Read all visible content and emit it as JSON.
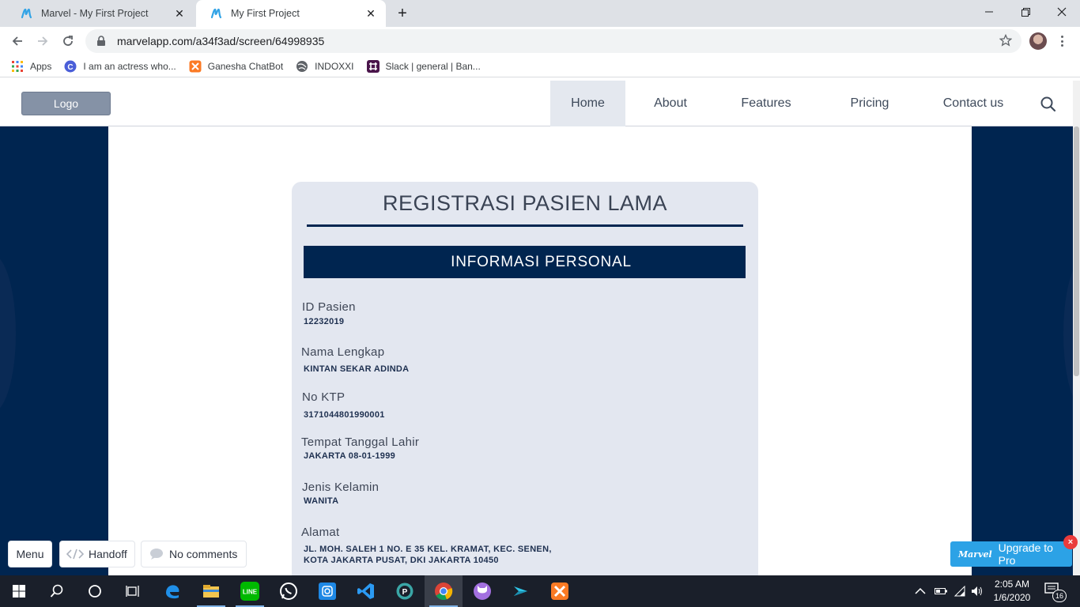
{
  "browser": {
    "tabs": [
      {
        "title": "Marvel - My First Project",
        "active": false
      },
      {
        "title": "My First Project",
        "active": true
      }
    ],
    "url": "marvelapp.com/a34f3ad/screen/64998935",
    "bookmarks": [
      {
        "label": "Apps",
        "icon": "apps-grid-icon"
      },
      {
        "label": "I am an actress who...",
        "icon": "c-circle-icon"
      },
      {
        "label": "Ganesha ChatBot",
        "icon": "xampp-icon"
      },
      {
        "label": "INDOXXI",
        "icon": "globe-icon"
      },
      {
        "label": "Slack | general | Ban...",
        "icon": "slack-icon"
      }
    ]
  },
  "site": {
    "logo_label": "Logo",
    "nav": [
      {
        "label": "Home",
        "active": true
      },
      {
        "label": "About"
      },
      {
        "label": "Features"
      },
      {
        "label": "Pricing"
      },
      {
        "label": "Contact us"
      }
    ]
  },
  "form": {
    "title": "REGISTRASI PASIEN LAMA",
    "section": "INFORMASI PERSONAL",
    "fields": [
      {
        "label": "ID Pasien",
        "value": "12232019"
      },
      {
        "label": "Nama Lengkap",
        "value": "KINTAN SEKAR ADINDA"
      },
      {
        "label": "No KTP",
        "value": "3171044801990001"
      },
      {
        "label": "Tempat Tanggal Lahir",
        "value": "JAKARTA 08-01-1999"
      },
      {
        "label": "Jenis Kelamin",
        "value": "WANITA"
      },
      {
        "label": "Alamat",
        "value_line1": "JL. MOH. SALEH 1 NO. E 35 KEL. KRAMAT, KEC. SENEN,",
        "value_line2": "KOTA JAKARTA PUSAT, DKI JAKARTA 10450"
      }
    ]
  },
  "marvel": {
    "menu_label": "Menu",
    "handoff_label": "Handoff",
    "comments_label": "No comments",
    "upgrade_brand": "Marvel",
    "upgrade_label": "Upgrade to Pro",
    "close_glyph": "×"
  },
  "taskbar": {
    "time": "2:05 AM",
    "date": "1/6/2020",
    "notification_count": "16"
  },
  "colors": {
    "navy": "#002550",
    "card_bg": "#e3e7f0",
    "upgrade_blue": "#2ca2e6"
  }
}
